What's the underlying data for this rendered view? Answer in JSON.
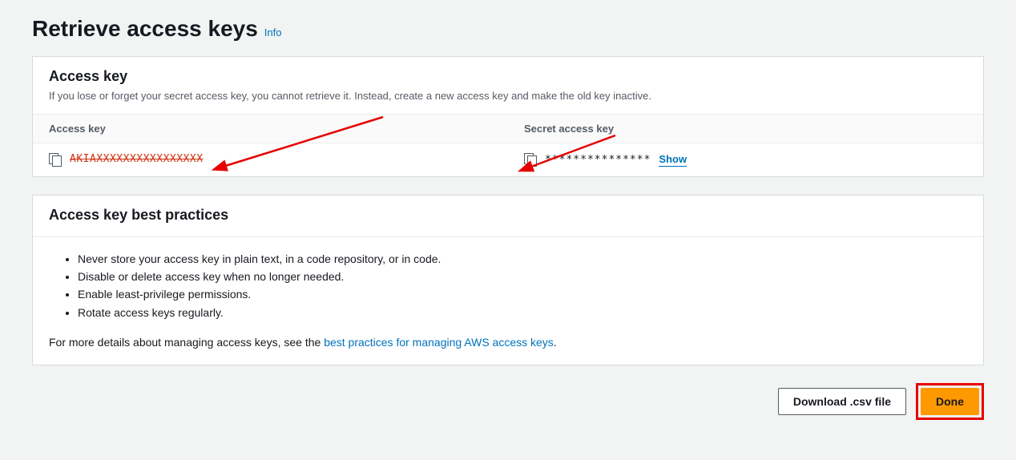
{
  "header": {
    "title": "Retrieve access keys",
    "info": "Info"
  },
  "accessKeyPanel": {
    "title": "Access key",
    "description": "If you lose or forget your secret access key, you cannot retrieve it. Instead, create a new access key and make the old key inactive.",
    "col1Label": "Access key",
    "col2Label": "Secret access key",
    "accessKeyValue": "AKIAXXXXXXXXXXXXXXXX",
    "secretMasked": "***************",
    "showLabel": "Show"
  },
  "bestPractices": {
    "title": "Access key best practices",
    "items": [
      "Never store your access key in plain text, in a code repository, or in code.",
      "Disable or delete access key when no longer needed.",
      "Enable least-privilege permissions.",
      "Rotate access keys regularly."
    ],
    "detailsPrefix": "For more details about managing access keys, see the ",
    "detailsLink": "best practices for managing AWS access keys",
    "detailsSuffix": "."
  },
  "footer": {
    "download": "Download .csv file",
    "done": "Done"
  }
}
